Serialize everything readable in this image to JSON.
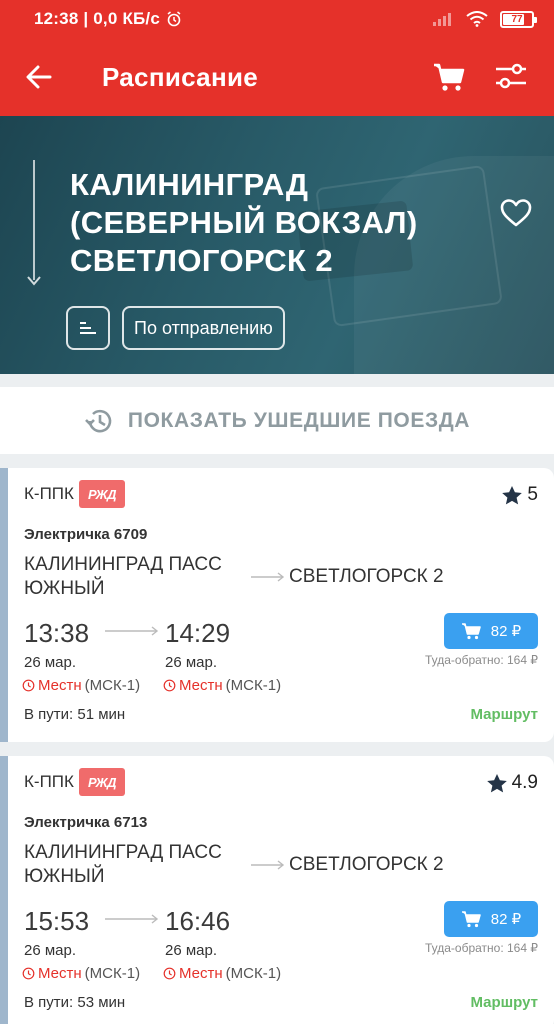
{
  "status_bar": {
    "time": "12:38 | 0,0 КБ/с",
    "battery": "77",
    "battery_level": 0.77
  },
  "app_bar": {
    "title": "Расписание",
    "icons": [
      "back-arrow-icon",
      "cart-icon",
      "filter-sliders-icon"
    ]
  },
  "hero": {
    "route": "КАЛИНИНГРАД\n(СЕВЕРНЫЙ ВОКЗАЛ)\nСВЕТЛОГОРСК 2",
    "sort_label": "По отправлению"
  },
  "show_departed": {
    "label": "ПОКАЗАТЬ УШЕДШИЕ ПОЕЗДА"
  },
  "colors": {
    "brand_red": "#e5312a",
    "buy_blue": "#3aa0f0",
    "route_green": "#62bd63",
    "hero_teal": "#285a67"
  },
  "trains": [
    {
      "carrier": "К-ППК",
      "logo": "РЖД",
      "rating": "5",
      "name": "Электричка 6709",
      "from": "КАЛИНИНГРАД ПАСС ЮЖНЫЙ",
      "to": "СВЕТЛОГОРСК 2",
      "dep_time": "13:38",
      "arr_time": "14:29",
      "dep_date": "26 мар.",
      "arr_date": "26 мар.",
      "tz_local": "Местн",
      "tz_msk": "(МСК-1)",
      "duration": "В пути: 51 мин",
      "price": "82 ₽",
      "round_trip": "Туда-обратно: 164 ₽",
      "route_link": "Маршрут"
    },
    {
      "carrier": "К-ППК",
      "logo": "РЖД",
      "rating": "4.9",
      "name": "Электричка 6713",
      "from": "КАЛИНИНГРАД ПАСС ЮЖНЫЙ",
      "to": "СВЕТЛОГОРСК 2",
      "dep_time": "15:53",
      "arr_time": "16:46",
      "dep_date": "26 мар.",
      "arr_date": "26 мар.",
      "tz_local": "Местн",
      "tz_msk": "(МСК-1)",
      "duration": "В пути: 53 мин",
      "price": "82 ₽",
      "round_trip": "Туда-обратно: 164 ₽",
      "route_link": "Маршрут"
    }
  ]
}
